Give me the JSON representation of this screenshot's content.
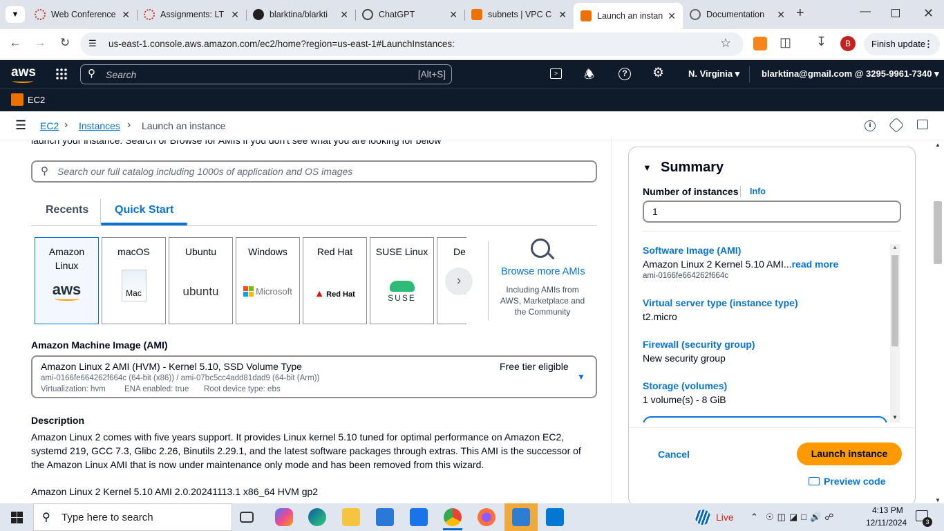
{
  "browser": {
    "tabs": [
      {
        "title": "Web Conference",
        "icon": "webex-icon"
      },
      {
        "title": "Assignments: LT",
        "icon": "canvas-icon"
      },
      {
        "title": "blarktina/blarkti",
        "icon": "github-icon"
      },
      {
        "title": "ChatGPT",
        "icon": "chatgpt-icon"
      },
      {
        "title": "subnets | VPC C",
        "icon": "aws-cube-icon"
      },
      {
        "title": "Launch an instan",
        "icon": "aws-ec2-icon"
      },
      {
        "title": "Documentation",
        "icon": "globe-icon"
      }
    ],
    "url": "us-east-1.console.aws.amazon.com/ec2/home?region=us-east-1#LaunchInstances:",
    "profile_initial": "B",
    "finish_update": "Finish update"
  },
  "aws": {
    "logo": "aws",
    "search_placeholder": "Search",
    "search_shortcut": "[Alt+S]",
    "region": "N. Virginia",
    "account": "blarktina@gmail.com @ 3295-9961-7340",
    "service": "EC2"
  },
  "breadcrumb": [
    "EC2",
    "Instances",
    "Launch an instance"
  ],
  "left": {
    "cutoff_text": "launch your instance. Search or Browse for AMIs if you don't see what you are looking for below",
    "catalog_placeholder": "Search our full catalog including 1000s of application and OS images",
    "tabs": [
      "Recents",
      "Quick Start"
    ],
    "os_cards": [
      {
        "label": "Amazon Linux",
        "logo": "aws"
      },
      {
        "label": "macOS",
        "logo": "Mac"
      },
      {
        "label": "Ubuntu",
        "logo": "ubuntu"
      },
      {
        "label": "Windows",
        "logo": "Microsoft"
      },
      {
        "label": "Red Hat",
        "logo": "Red Hat"
      },
      {
        "label": "SUSE Linux",
        "logo": "SUSE"
      },
      {
        "label": "De",
        "logo": "de"
      }
    ],
    "browse_more": "Browse more AMIs",
    "browse_sub": "Including AMIs from AWS, Marketplace and the Community",
    "ami_heading": "Amazon Machine Image (AMI)",
    "ami_name": "Amazon Linux 2 AMI (HVM) - Kernel 5.10, SSD Volume Type",
    "ami_free": "Free tier eligible",
    "ami_ids": "ami-0166fe664262f664c (64-bit (x86)) / ami-07bc5cc4add81dad9 (64-bit (Arm))",
    "ami_virt": "Virtualization: hvm",
    "ami_ena": "ENA enabled: true",
    "ami_root": "Root device type: ebs",
    "desc_heading": "Description",
    "desc_text": "Amazon Linux 2 comes with five years support. It provides Linux kernel 5.10 tuned for optimal performance on Amazon EC2, systemd 219, GCC 7.3, Glibc 2.26, Binutils 2.29.1, and the latest software packages through extras. This AMI is the successor of the Amazon Linux AMI that is now under maintenance only mode and has been removed from this wizard.",
    "desc_line2": "Amazon Linux 2 Kernel 5.10 AMI 2.0.20241113.1 x86_64 HVM gp2"
  },
  "summary": {
    "title": "Summary",
    "num_label": "Number of instances",
    "info": "Info",
    "num_value": "1",
    "items": [
      {
        "label": "Software Image (AMI)",
        "value": "Amazon Linux 2 Kernel 5.10 AMI...",
        "more": "read more",
        "sub": "ami-0166fe664262f664c"
      },
      {
        "label": "Virtual server type (instance type)",
        "value": "t2.micro"
      },
      {
        "label": "Firewall (security group)",
        "value": "New security group"
      },
      {
        "label": "Storage (volumes)",
        "value": "1 volume(s) - 8 GiB"
      }
    ],
    "cancel": "Cancel",
    "launch": "Launch instance",
    "preview": "Preview code"
  },
  "taskbar": {
    "search_placeholder": "Type here to search",
    "weather": "Live",
    "time": "4:13 PM",
    "date": "12/11/2024",
    "notif_count": "3"
  }
}
